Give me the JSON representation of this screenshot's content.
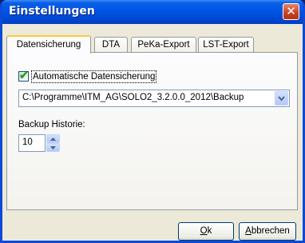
{
  "window": {
    "title": "Einstellungen",
    "close_symbol": "✕"
  },
  "tabs": [
    {
      "label": "Datensicherung",
      "active": true
    },
    {
      "label": "DTA",
      "active": false
    },
    {
      "label": "PeKa-Export",
      "active": false
    },
    {
      "label": "LST-Export",
      "active": false
    }
  ],
  "backup": {
    "auto_label": "Automatische Datensicherung",
    "auto_checked": true,
    "path": "C:\\Programme\\ITM_AG\\SOLO2_3.2.0.0_2012\\Backup",
    "history_label": "Backup Historie:",
    "history_value": "10"
  },
  "buttons": {
    "ok_mnemonic": "O",
    "ok_rest": "k",
    "cancel_mnemonic": "A",
    "cancel_rest": "bbrechen"
  },
  "colors": {
    "titlebar": "#0055e5",
    "close": "#c8411c",
    "dialog_bg": "#ece9d8",
    "checkmark": "#21a121"
  }
}
